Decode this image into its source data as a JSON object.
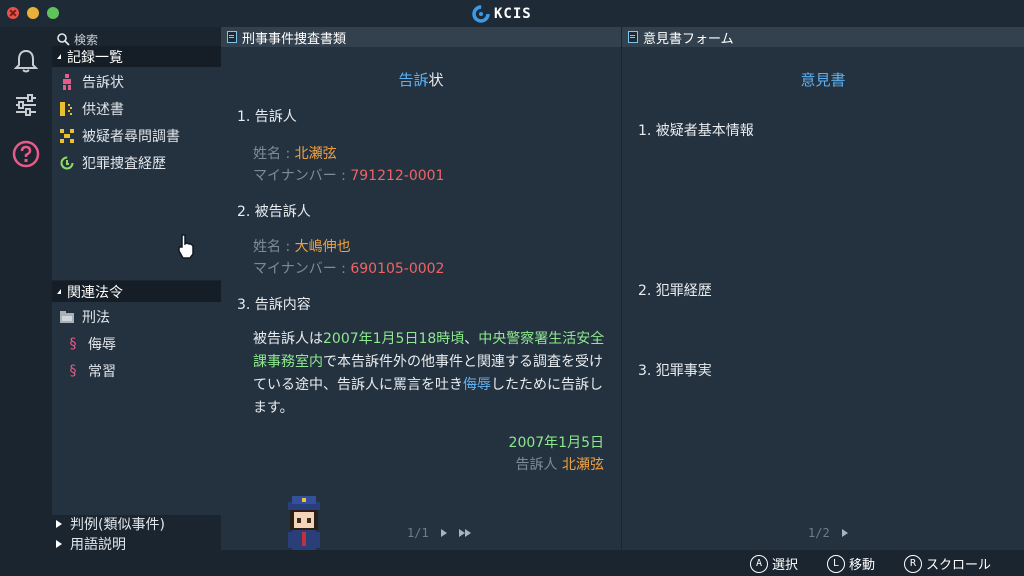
{
  "app": {
    "title": "KCIS",
    "brand_color": "#3c9be8"
  },
  "sidebar_icons": [
    "bell-icon",
    "sliders-icon",
    "help-icon"
  ],
  "left_panel": {
    "search_label": "検索",
    "records_header": "記録一覧",
    "records": [
      {
        "label": "告訴状",
        "icon": "figure-icon",
        "color": "#e85a8a"
      },
      {
        "label": "供述書",
        "icon": "statement-icon",
        "color": "#e8c030"
      },
      {
        "label": "被疑者尋問調書",
        "icon": "interrogation-icon",
        "color": "#e8c030"
      },
      {
        "label": "犯罪捜査経歴",
        "icon": "history-icon",
        "color": "#8ed86a"
      }
    ],
    "law_header": "関連法令",
    "law_folder": "刑法",
    "laws": [
      "侮辱",
      "常習"
    ],
    "bottom_items": [
      "判例(類似事件)",
      "用語説明"
    ]
  },
  "doc": {
    "header": "刑事事件捜査書類",
    "title_a": "告訴",
    "title_b": "状",
    "s1": "1. 告訴人",
    "name_label": "姓名 : ",
    "name1": "北瀬弦",
    "mynum_label": "マイナンバー : ",
    "mynum1": "791212-0001",
    "s2": "2. 被告訴人",
    "name2": "大嶋伸也",
    "mynum2": "690105-0002",
    "s3": "3. 告訴内容",
    "body": {
      "p1": "被告訴人は",
      "p2": "2007年1月5日18時頃",
      "p3": "、",
      "p4": "中央警察署生活安全課事務室内",
      "p5": "で本告訴件外の他事件と関連する調査を受けている途中、告訴人に罵言を吐き",
      "p6": "侮辱",
      "p7": "したために告訴します。"
    },
    "date": "2007年1月5日",
    "sign_label": "告訴人",
    "sign_name": "北瀬弦",
    "page": "1/1"
  },
  "opinion": {
    "header": "意見書フォーム",
    "title": "意見書",
    "s1": "1. 被疑者基本情報",
    "s2": "2. 犯罪経歴",
    "s3": "3. 犯罪事実",
    "page": "1/2"
  },
  "footer": [
    {
      "button": "A",
      "label": "選択"
    },
    {
      "button": "L",
      "label": "移動"
    },
    {
      "button": "R",
      "label": "スクロール"
    }
  ]
}
